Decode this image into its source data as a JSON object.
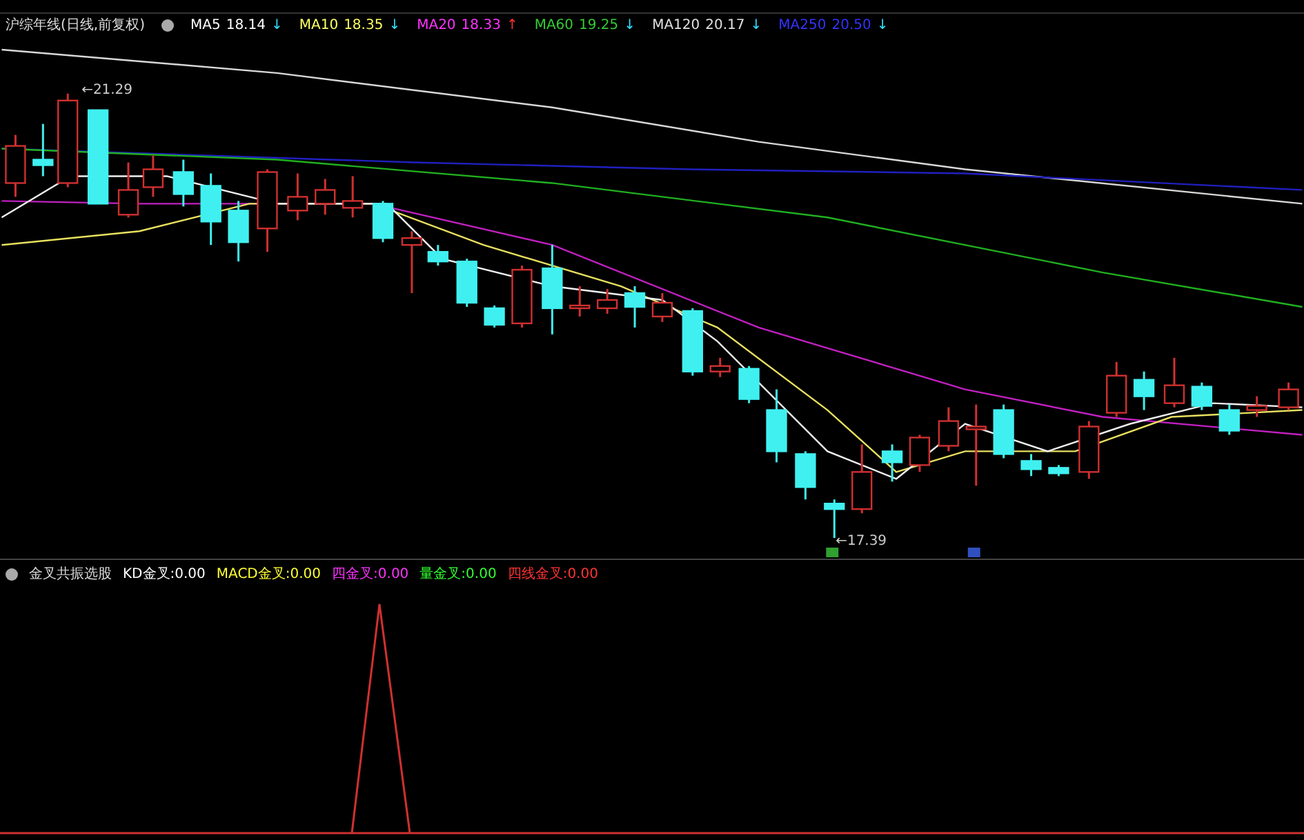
{
  "chart": {
    "title": "沪综年线(日线,前复权)",
    "ma_items": [
      {
        "label": "MA5",
        "value": "18.14",
        "arrow": {
          "text": "↓",
          "color": "#30e0ff"
        },
        "color": "#ffffff"
      },
      {
        "label": "MA10",
        "value": "18.35",
        "arrow": {
          "text": "↓",
          "color": "#30e0ff"
        },
        "color": "#ffff66"
      },
      {
        "label": "MA20",
        "value": "18.33",
        "arrow": {
          "text": "↑",
          "color": "#ff3030"
        },
        "color": "#ff33ff"
      },
      {
        "label": "MA60",
        "value": "19.25",
        "arrow": {
          "text": "↓",
          "color": "#30e0ff"
        },
        "color": "#33cc33"
      },
      {
        "label": "MA120",
        "value": "20.17",
        "arrow": {
          "text": "↓",
          "color": "#30e0ff"
        },
        "color": "#e0e0e0"
      },
      {
        "label": "MA250",
        "value": "20.50",
        "arrow": {
          "text": "↓",
          "color": "#30e0ff"
        },
        "color": "#3333ff"
      }
    ],
    "high_label": "←21.29",
    "low_label": "←17.39"
  },
  "indicator": {
    "title": "金叉共振选股",
    "items": [
      {
        "label": "KD金叉:",
        "value": "0.00",
        "color": "#ffffff"
      },
      {
        "label": "MACD金叉:",
        "value": "0.00",
        "color": "#ffff33"
      },
      {
        "label": "四金叉:",
        "value": "0.00",
        "color": "#ff33ff"
      },
      {
        "label": "量金叉:",
        "value": "0.00",
        "color": "#33ff33"
      },
      {
        "label": "四线金叉:",
        "value": "0.00",
        "color": "#ff3333"
      }
    ]
  }
}
